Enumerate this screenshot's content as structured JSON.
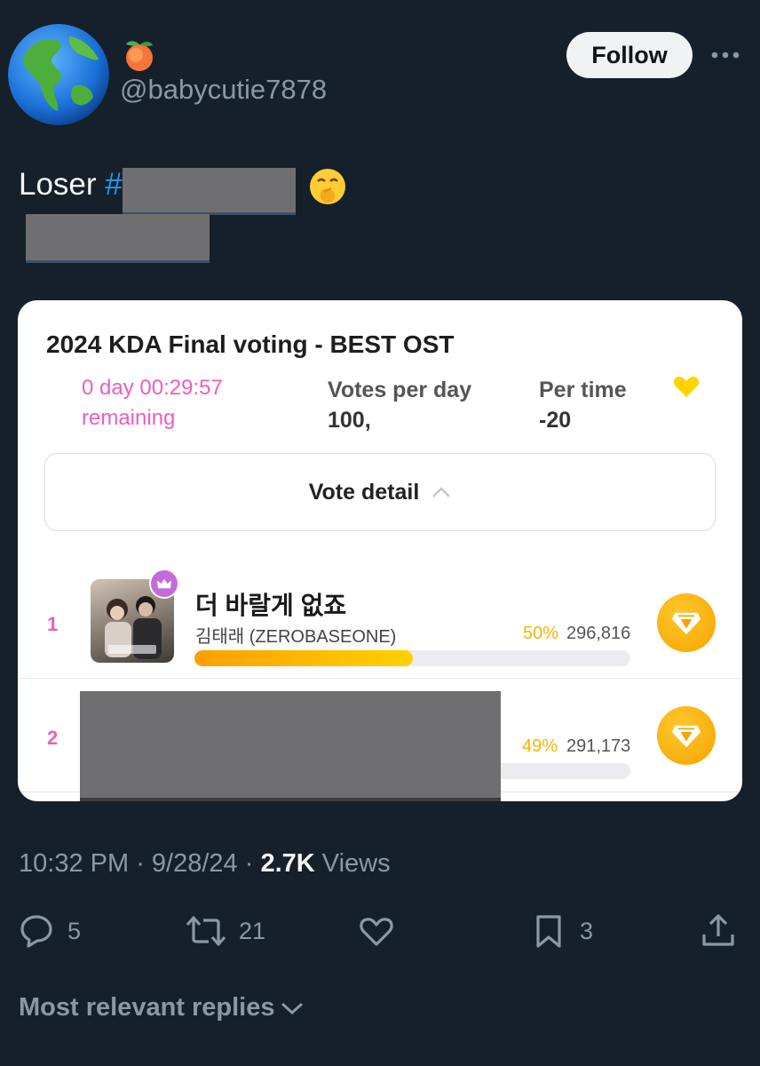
{
  "author": {
    "display_name_emoji": "🍑",
    "handle": "@babycutie7878"
  },
  "follow_label": "Follow",
  "tweet": {
    "text_prefix": "Loser ",
    "hashtag_symbol": "#",
    "emoji": "🤭"
  },
  "vote_card": {
    "title": "2024 KDA Final voting - BEST OST",
    "timer_line1": "0 day 00:29:57",
    "timer_line2": "remaining",
    "votes_per_day_label": "Votes per day",
    "votes_per_day_value": "100,",
    "per_time_label": "Per time",
    "per_time_value": "-20",
    "vote_detail_label": "Vote detail",
    "entries": [
      {
        "rank": "1",
        "song": "더 바랄게 없죠",
        "artist": "김태래 (ZEROBASEONE)",
        "percent": "50%",
        "votes": "296,816",
        "share": 0.5
      },
      {
        "rank": "2",
        "percent": "49%",
        "votes": "291,173",
        "share": 0.49
      }
    ]
  },
  "meta": {
    "time": "10:32 PM",
    "sep": " · ",
    "date": "9/28/24",
    "views_count": "2.7K",
    "views_label": " Views"
  },
  "actions": {
    "replies": "5",
    "reposts": "21",
    "bookmarks": "3"
  },
  "replies_sort_label": "Most relevant replies",
  "colors": {
    "background": "#15202b",
    "link": "#1d9bf0",
    "muted": "#8b98a5",
    "accent_pink": "#ec5dc2",
    "gold": "#f6a400"
  }
}
